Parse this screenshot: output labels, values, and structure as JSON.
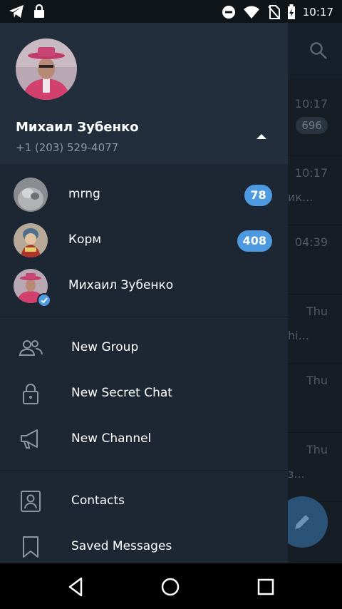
{
  "status_bar": {
    "time": "10:17",
    "left_icons": [
      "telegram-icon",
      "lock-icon"
    ],
    "right_icons": [
      "do-not-disturb-icon",
      "wifi-icon",
      "battery-charging-icon"
    ]
  },
  "background_chats": {
    "times": [
      "10:17",
      "10:17",
      "04:39",
      "Thu",
      "Thu",
      "Thu"
    ],
    "snippets": [
      "ик...",
      "hi...",
      "з..."
    ],
    "unread": "696"
  },
  "drawer": {
    "profile": {
      "name": "Михаил Зубенко",
      "phone": "+1 (203) 529-4077"
    },
    "accounts": [
      {
        "name": "mrng",
        "badge": "78"
      },
      {
        "name": "Корм",
        "badge": "408"
      },
      {
        "name": "Михаил Зубенко"
      }
    ],
    "menu": [
      {
        "label": "New Group",
        "icon": "group-icon"
      },
      {
        "label": "New Secret Chat",
        "icon": "lock-icon"
      },
      {
        "label": "New Channel",
        "icon": "megaphone-icon"
      },
      {
        "label": "Contacts",
        "icon": "contacts-icon"
      },
      {
        "label": "Saved Messages",
        "icon": "bookmark-icon"
      }
    ]
  },
  "colors": {
    "drawer_bg": "#1d2733",
    "header_bg": "#232e3c",
    "badge": "#4e9ae0",
    "fab": "#2b5277"
  }
}
